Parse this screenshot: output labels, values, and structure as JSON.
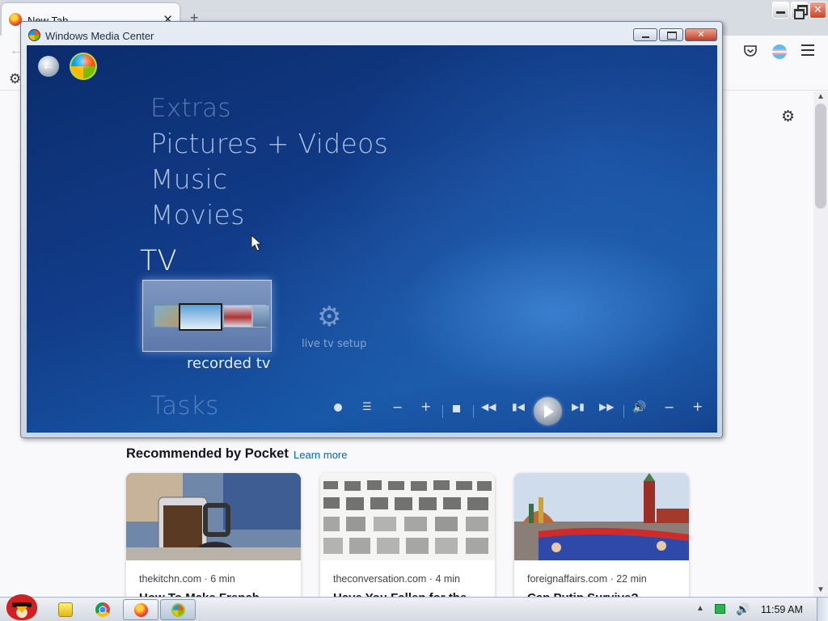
{
  "browser": {
    "tab_title": "New Tab",
    "tab_close": "✕",
    "new_tab": "+",
    "back": "←",
    "bookmarks_gear": "⚙",
    "page_gear": "⚙",
    "scroll_up": "▲",
    "scroll_down": "▼"
  },
  "pocket": {
    "heading": "Recommended by Pocket",
    "learn_more": "Learn more",
    "cards": [
      {
        "source": "thekitchn.com · 6 min",
        "title": "How To Make French"
      },
      {
        "source": "theconversation.com · 4 min",
        "title": "Have You Fallen for the"
      },
      {
        "source": "foreignaffairs.com · 22 min",
        "title": "Can Putin Survive?"
      }
    ]
  },
  "wmc": {
    "window_title": "Windows Media Center",
    "menu": {
      "extras": "Extras",
      "pictures_videos": "Pictures + Videos",
      "music": "Music",
      "movies": "Movies",
      "tv": "TV",
      "tasks": "Tasks"
    },
    "tiles": {
      "recorded_tv": "recorded tv",
      "live_tv_setup": "live tv setup",
      "setup_gear": "⚙"
    },
    "transport": {
      "guide": "☰",
      "ch_minus": "−",
      "ch_plus": "+",
      "rewind": "◀◀",
      "prev": "▮◀",
      "next": "▶▮",
      "fast_forward": "▶▶",
      "mute": "🔊",
      "vol_minus": "−",
      "vol_plus": "+"
    }
  },
  "taskbar": {
    "tray_arrow": "▲",
    "volume": "🔊",
    "clock": "11:59 AM"
  }
}
